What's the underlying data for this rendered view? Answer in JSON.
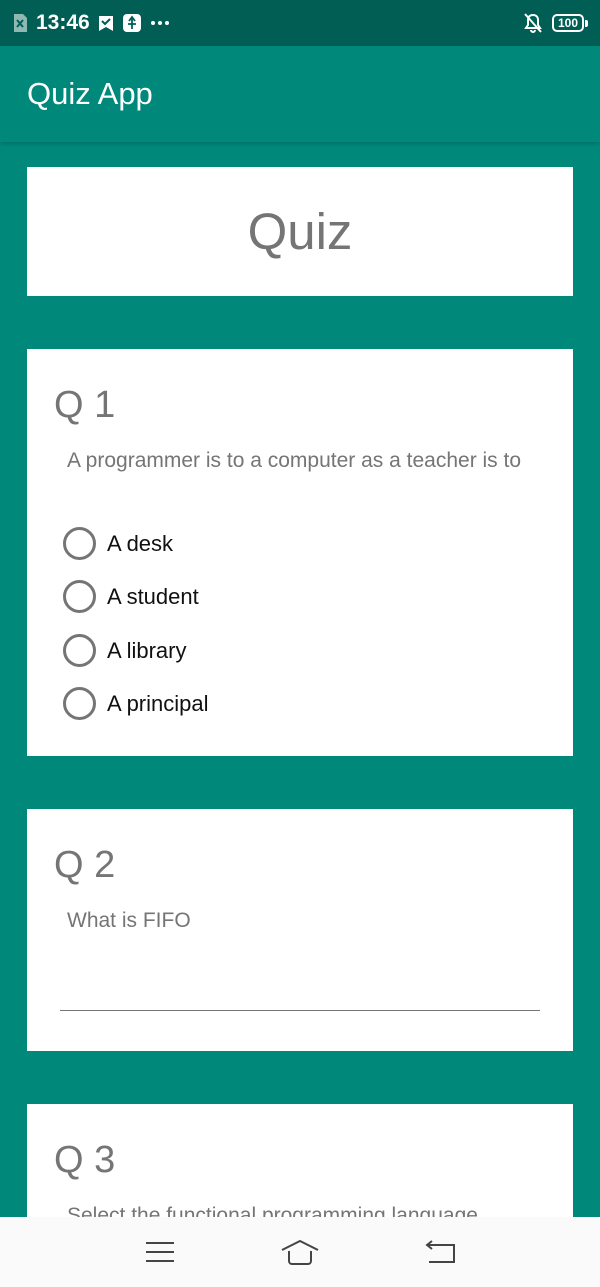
{
  "status_bar": {
    "time": "13:46",
    "battery": "100",
    "icons": [
      "sim-x-icon",
      "check-shield-icon",
      "usb-icon",
      "more-dots-icon",
      "bell-off-icon",
      "battery-icon"
    ]
  },
  "app_bar": {
    "title": "Quiz App"
  },
  "header_card": {
    "title": "Quiz"
  },
  "questions": [
    {
      "number": "Q 1",
      "text": "A programmer is to a computer as a teacher is to",
      "options": [
        "A desk",
        "A student",
        "A library",
        "A principal"
      ]
    },
    {
      "number": "Q 2",
      "text": "What is FIFO",
      "answer_value": ""
    },
    {
      "number": "Q 3",
      "text": "Select the functional programming language"
    }
  ],
  "nav_bar": {
    "icons": [
      "menu-icon",
      "home-icon",
      "back-icon"
    ]
  },
  "colors": {
    "primary": "#00897b",
    "primary_dark": "#005e55",
    "text_gray": "#757575"
  }
}
